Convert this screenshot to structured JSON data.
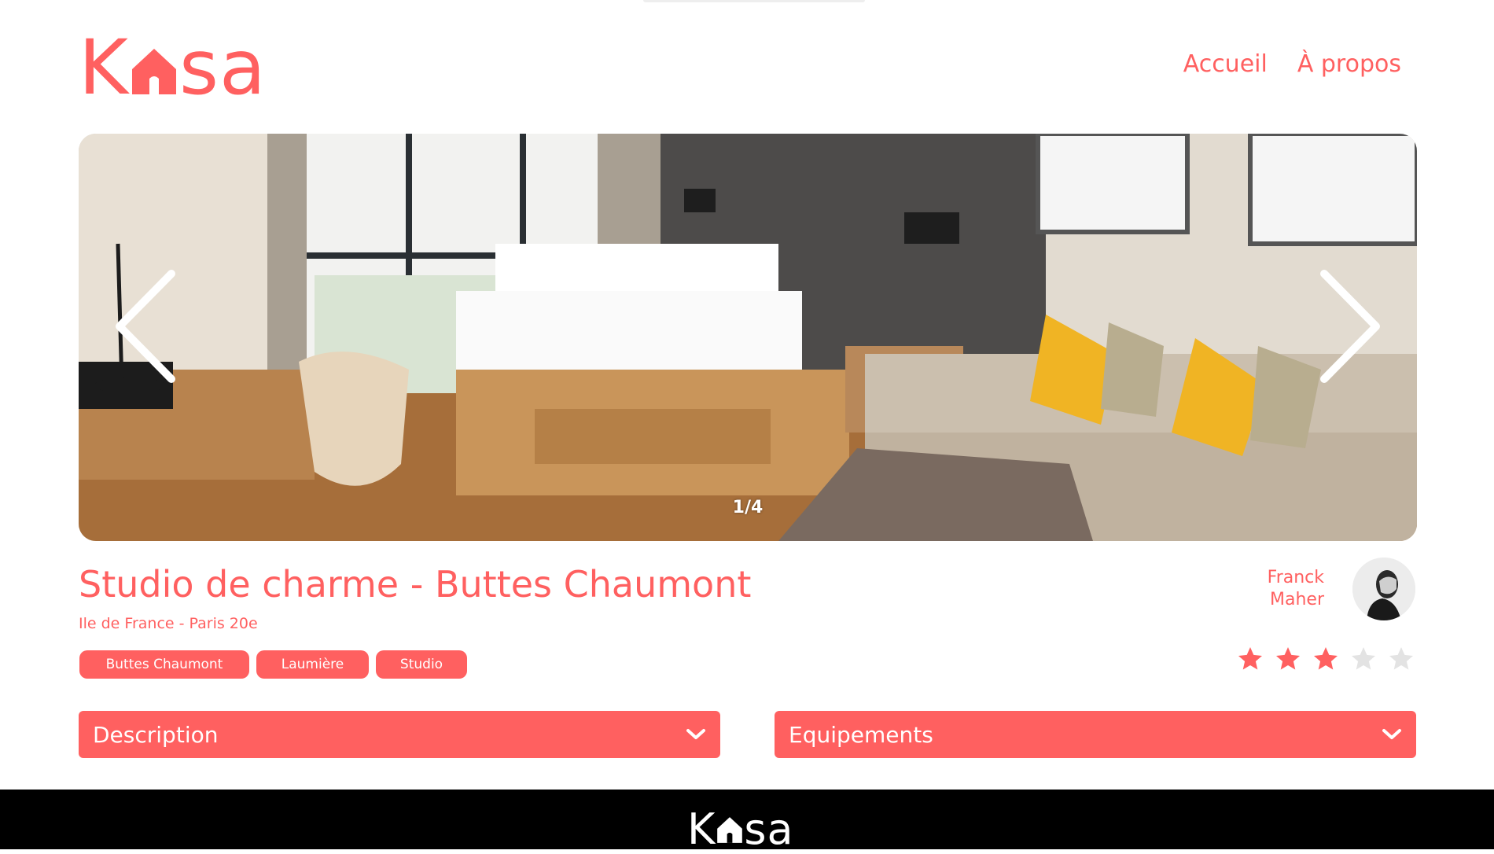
{
  "header": {
    "logo_letters": {
      "first": "K",
      "last": "sa"
    },
    "nav": [
      {
        "label": "Accueil"
      },
      {
        "label": "À propos"
      }
    ]
  },
  "gallery": {
    "counter": "1/4",
    "current": 1,
    "total": 4,
    "prev_icon": "chevron-left-icon",
    "next_icon": "chevron-right-icon"
  },
  "listing": {
    "title": "Studio de charme - Buttes Chaumont",
    "location": "Ile de France - Paris 20e",
    "tags": [
      "Buttes Chaumont",
      "Laumière",
      "Studio"
    ],
    "host": {
      "first_name": "Franck",
      "last_name": "Maher"
    },
    "rating": 3,
    "rating_max": 5
  },
  "collapses": {
    "description": {
      "label": "Description",
      "icon": "chevron-down-icon"
    },
    "equipments": {
      "label": "Equipements",
      "icon": "chevron-down-icon"
    }
  },
  "footer": {
    "logo_letters": {
      "first": "K",
      "last": "sa"
    }
  },
  "colors": {
    "accent": "#FF6060",
    "star_off": "#E3E3E3",
    "footer_bg": "#000000"
  }
}
